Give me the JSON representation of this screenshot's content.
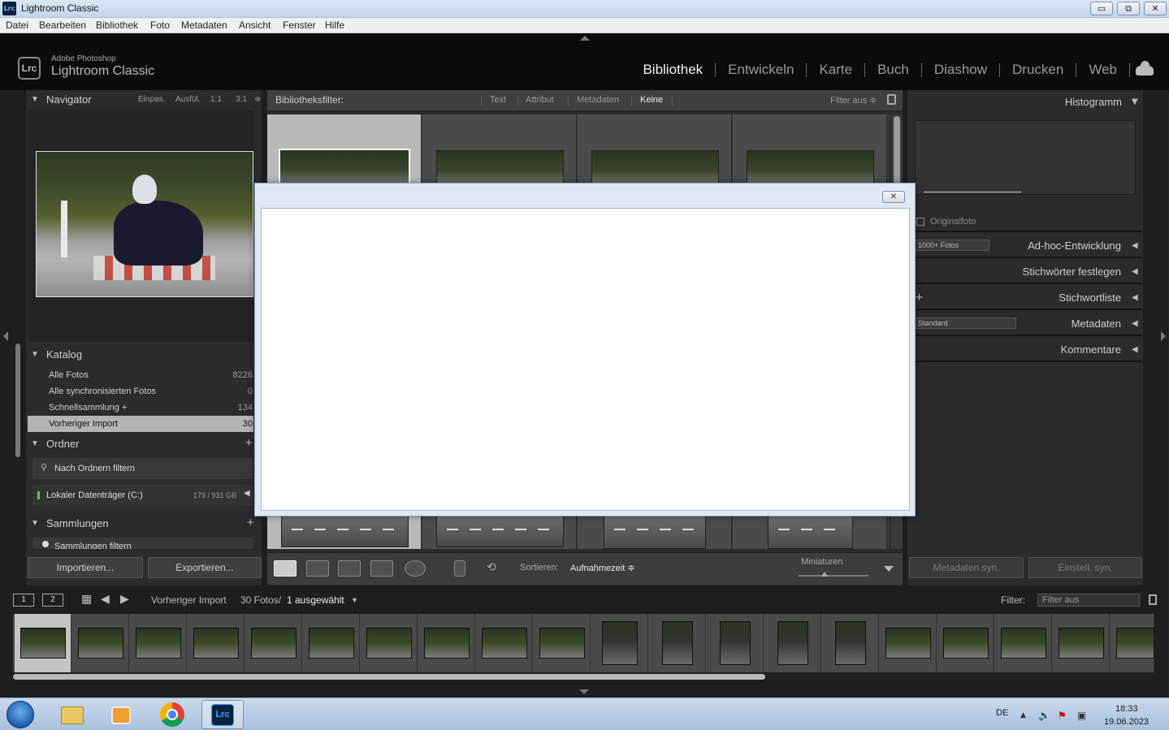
{
  "window": {
    "title": "Lightroom Classic",
    "icon": "Lrc",
    "minimize": "▭",
    "maximize": "⧉",
    "close": "✕"
  },
  "menu": [
    "Datei",
    "Bearbeiten",
    "Bibliothek",
    "Foto",
    "Metadaten",
    "Ansicht",
    "Fenster",
    "Hilfe"
  ],
  "brand": {
    "top": "Adobe Photoshop",
    "main": "Lightroom Classic",
    "badge": "Lrc"
  },
  "modules": [
    "Bibliothek",
    "Entwickeln",
    "Karte",
    "Buch",
    "Diashow",
    "Drucken",
    "Web"
  ],
  "active_module": "Bibliothek",
  "navigator": {
    "title": "Navigator",
    "options": [
      "Einpas.",
      "Ausfül.",
      "1:1",
      "3:1"
    ]
  },
  "catalog": {
    "title": "Katalog",
    "items": [
      {
        "name": "Alle Fotos",
        "count": "8226"
      },
      {
        "name": "Alle synchronisierten Fotos",
        "count": "0"
      },
      {
        "name": "Schnellsammlung  +",
        "count": "134"
      },
      {
        "name": "Vorheriger Import",
        "count": "30"
      }
    ]
  },
  "folders": {
    "title": "Ordner",
    "filter_label": "Nach Ordnern filtern",
    "volume": {
      "name": "Lokaler Datenträger (C:)",
      "size": "179 / 931 GB"
    }
  },
  "collections": {
    "title": "Sammlungen",
    "filter_label": "Sammlungen filtern"
  },
  "left_buttons": {
    "import": "Importieren...",
    "export": "Exportieren..."
  },
  "library_filter": {
    "label": "Bibliotheksfilter:",
    "tabs": [
      "Text",
      "Attribut",
      "Metadaten",
      "Keine"
    ],
    "active_tab": "Keine",
    "filter_preset": "Filter aus ≑"
  },
  "toolbar": {
    "sort_label": "Sortieren:",
    "sort_value": "Aufnahmezeit ≑",
    "thumbnails_label": "Miniaturen"
  },
  "right_panel": {
    "histogram": "Histogramm",
    "original_photo": "Originalfoto",
    "photos_select": "1000+ Fotos",
    "quick_develop": "Ad-hoc-Entwicklung",
    "keywording": "Stichwörter festlegen",
    "keyword_list": "Stichwortliste",
    "metadata_preset": "Standard",
    "metadata": "Metadaten",
    "comments": "Kommentare",
    "sync_meta": "Metadaten syn.",
    "sync_settings": "Einstell. syn."
  },
  "filmstrip_bar": {
    "screen1": "1",
    "screen2": "2",
    "source": "Vorheriger Import",
    "count": "30 Fotos/",
    "selected": "1 ausgewählt",
    "filter_label": "Filter:",
    "filter_value": "Filter aus"
  },
  "taskbar": {
    "lang": "DE",
    "time": "18:33",
    "date": "19.06.2023",
    "lrc_label": "Lrc"
  },
  "dialog": {
    "close": "✕"
  },
  "colors": {
    "accent": "#f2f2f2",
    "panel": "#2b2b2b",
    "selected": "#b4b4b4"
  }
}
